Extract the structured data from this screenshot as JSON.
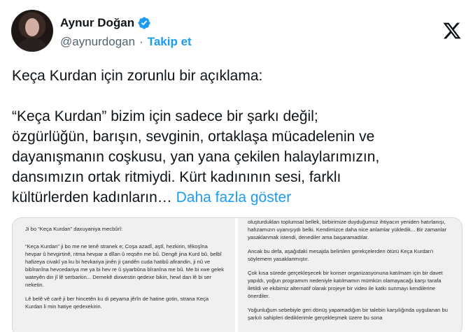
{
  "header": {
    "display_name": "Aynur Doğan",
    "handle": "@aynurdogan",
    "separator": "·",
    "follow_label": "Takip et",
    "verified_color": "#1d9bf0",
    "icons": {
      "verified": "verified-badge-icon",
      "logo": "x-logo-icon"
    }
  },
  "tweet": {
    "text": "Keça Kurdan için zorunlu bir açıklama:\n\n“Keça Kurdan” bizim için sadece bir şarkı değil;\nözgürlüğün, barışın, sevginin, ortaklaşa mücadelenin ve\ndayanışmanın coşkusu, yan yana çekilen halaylarımızın,\ndansımızın ortak ritmiydi. Kürt kadınının sesi, farklı\nkültürlerden kadınların… ",
    "show_more": "Daha fazla göster"
  },
  "media": {
    "left": {
      "title": "Ji bo “Keça Kurdan” daxuyaniya mecbûrî:",
      "p1": "“Keça Kurdan” ji bo me ne tenê stranek e; Coşa azadî, aştî, hezkirin, têkoşîna hevpar û hevgirtinê, ritma hevpar a dîlan û reqsên me bû. Dengê jina Kurd bû, belbî hafizeya civakî ya ku bi hevkariya jinên ji çandên cuda hatibû afirandin, ji nû ve bibîranîna hevcedariya me ya bi hev re û şiyarbûna bîranîna me bû. Me bi xwe gelek wateyên din jî lê serbarkin... Demekê dixwestin qedexe bikin, hewl dan lê bi ser neketin.",
      "p2": "Lê belê vê carê ji ber hincetên ku di peyama jêrîn de hatine gotin, strana Keça Kurdan li min hatiye qedexekirin."
    },
    "right": {
      "p0": "oluşturdukları toplumsal bellek, birbirimize duyduğumuz ihtiyacın yeniden hatırlanışı, hafızamızın uyanışıydı belki. Kendimizce daha nice anlamlar yükledik... Bir zamanlar yasaklanmak istendi, denediler ama başaramadılar.",
      "p1": "Ancak bu defa, aşağıdaki mesajda belirtilen gerekçelerden ötürü Keça Kurdan'ı söylemem yasaklanmıştır.",
      "p2": "Çok kısa sürede gerçekleşecek bir konser organizasyonuna katılmam için bir davet yapıldı, yoğun programım nedeniyle katılmamın mümkün olamayacağı karşı tarafa iletildi ve ekibimiz alternatif olarak projeye bir video ile katkı sunmayı kendilerine önerdiler.",
      "p3": "Yoğunluğum sebebiyle geri dönüş yapamadığım bir talebin karşılığında uygulanan bu şarkılı sahipleri dediklerimle gerçekleşmek üzere bu sona"
    }
  }
}
